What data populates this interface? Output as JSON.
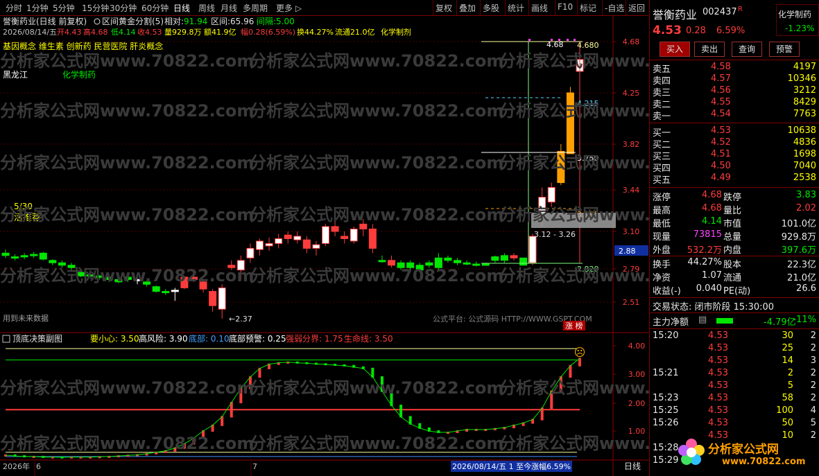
{
  "toolbar": {
    "left": [
      "分时",
      "1分钟",
      "5分钟",
      "15分钟",
      "30分钟",
      "60分钟",
      "日线",
      "周线",
      "月线",
      "多周期",
      "更多 ▷"
    ],
    "active_index": 6,
    "right": [
      "复权",
      "叠加",
      "多股",
      "统计",
      "画线",
      "F10",
      "标记",
      "-自选",
      "返回"
    ]
  },
  "header": {
    "line1_title": "誉衡药业(日线 前复权)",
    "line1_indicator": "区间黄金分割(5)",
    "line1_rel_label": "相对:",
    "line1_rel_value": "91.94",
    "line1_range_label": "区间:",
    "line1_range_value": "65.96",
    "line1_gap_label": "间隔:",
    "line1_gap_value": "5.00",
    "line2_date": "2026/08/14/五",
    "line2_open": "开4.43",
    "line2_high": "高4.68",
    "line2_low": "低4.14",
    "line2_close": "收4.53",
    "line2_vol": "量929.8万",
    "line2_amt": "额41.9亿",
    "line2_chg": "幅0.28(6.59%)",
    "line2_turn": "换44.27%",
    "line2_float": "流通21.0亿",
    "line2_ind": "化学制剂",
    "concepts": "基因概念 维生素 创新药 民营医院 肝炎概念",
    "region": "黑龙江",
    "industry": "化学制药",
    "note_date": "5/30",
    "note_text": "活推荐",
    "future_text": "用到未来数据",
    "gspt": "公式平台: 公式源码 HTTP://WWW.GSPT.COM",
    "tag": "涨 榜"
  },
  "price_axis": {
    "ticks": [
      "4.68",
      "4.25",
      "3.82",
      "3.44",
      "3.10",
      "2.79",
      "2.51"
    ],
    "current": "2.88"
  },
  "fib": {
    "labels": [
      "4.680",
      "4.215",
      "3.750",
      "3.285",
      "2.820"
    ],
    "left_top": "4.68",
    "range_text": "3.12 - 3.26"
  },
  "low_label": "←2.37",
  "sub": {
    "title": "顶底决策副图",
    "items": [
      {
        "label": "要小心: 3.50",
        "color": "#ffff00"
      },
      {
        "label": "高风险: 3.90",
        "color": "#ffffff"
      },
      {
        "label": "底部: 0.10",
        "color": "#40a0ff"
      },
      {
        "label": "底部预警: 0.25",
        "color": "#ffffff"
      },
      {
        "label": "强弱分界: 1.75",
        "color": "#ff3c3c"
      },
      {
        "label": "生命线: 3.50",
        "color": "#ff3c3c"
      }
    ],
    "ticks": [
      "4.00",
      "3.00",
      "2.00",
      "1.00"
    ],
    "emoji": "☹"
  },
  "timeline": {
    "year": "2026年",
    "m1": "6",
    "m2": "7",
    "status": "2026/08/14/五 1 至今涨幅6.59%",
    "period": "日线"
  },
  "quote": {
    "name": "誉衡药业",
    "code": "002437",
    "flag": "R",
    "industry": "化学制药",
    "industry_chg": "-1.23%",
    "price": "4.53",
    "chg": "0.28",
    "pct": "6.59%",
    "buttons": [
      "买入",
      "卖出",
      "查询",
      "预警"
    ],
    "asks": [
      {
        "label": "卖五",
        "price": "4.58",
        "vol": "4197"
      },
      {
        "label": "卖四",
        "price": "4.57",
        "vol": "10346"
      },
      {
        "label": "卖三",
        "price": "4.56",
        "vol": "3212"
      },
      {
        "label": "卖二",
        "price": "4.55",
        "vol": "8429"
      },
      {
        "label": "卖一",
        "price": "4.54",
        "vol": "7763"
      }
    ],
    "bids": [
      {
        "label": "买一",
        "price": "4.53",
        "vol": "10638"
      },
      {
        "label": "买二",
        "price": "4.52",
        "vol": "4836"
      },
      {
        "label": "买三",
        "price": "4.51",
        "vol": "1698"
      },
      {
        "label": "买四",
        "price": "4.50",
        "vol": "7040"
      },
      {
        "label": "买五",
        "price": "4.49",
        "vol": "2538"
      }
    ],
    "stats": [
      {
        "l1": "涨停",
        "v1": "4.68",
        "c1": "red",
        "l2": "跌停",
        "v2": "3.83",
        "c2": "green"
      },
      {
        "l1": "最高",
        "v1": "4.68",
        "c1": "red",
        "l2": "量比",
        "v2": "2.02",
        "c2": "red"
      },
      {
        "l1": "最低",
        "v1": "4.14",
        "c1": "green",
        "l2": "市值",
        "v2": "101.0亿",
        "c2": "white"
      },
      {
        "l1": "现量",
        "v1": "73815",
        "c1": "magenta",
        "l2": "总量",
        "v2": "929.8万",
        "c2": "white"
      },
      {
        "l1": "外盘",
        "v1": "532.2万",
        "c1": "red",
        "l2": "内盘",
        "v2": "397.6万",
        "c2": "green"
      }
    ],
    "stats2": [
      {
        "l1": "换手",
        "v1": "44.27%",
        "l2": "股本",
        "v2": "22.3亿"
      },
      {
        "l1": "净资",
        "v1": "1.07",
        "l2": "流通",
        "v2": "21.0亿"
      },
      {
        "l1": "收益(-)",
        "v1": "0.040",
        "l2": "PE(动)",
        "v2": "26.6"
      }
    ],
    "trade_state": "交易状态: 闭市阶段 15:30:00",
    "net_label": "主力净额",
    "net_value": "-4.79亿",
    "net_pct": "-11%",
    "ticks": [
      {
        "t": "15:20",
        "p": "4.53",
        "v": "30",
        "n": "2"
      },
      {
        "t": "",
        "p": "4.53",
        "v": "25",
        "n": "2"
      },
      {
        "t": "",
        "p": "4.53",
        "v": "14",
        "n": "3"
      },
      {
        "t": "15:21",
        "p": "4.53",
        "v": "2",
        "n": "2"
      },
      {
        "t": "",
        "p": "4.53",
        "v": "5",
        "n": "2"
      },
      {
        "t": "15:23",
        "p": "4.53",
        "v": "58",
        "n": "2"
      },
      {
        "t": "15:25",
        "p": "4.53",
        "v": "100",
        "n": "4"
      },
      {
        "t": "15:26",
        "p": "4.53",
        "v": "50",
        "n": "5"
      },
      {
        "t": "",
        "p": "4.53",
        "v": "10",
        "n": "2"
      },
      {
        "t": "15:28",
        "p": "",
        "v": "",
        "n": ""
      },
      {
        "t": "15:29",
        "p": "",
        "v": "",
        "n": ""
      }
    ],
    "logo_name": "分析家公式网",
    "logo_url": "www.70822.com"
  },
  "watermark": "分析家公式网www.70822.com"
}
